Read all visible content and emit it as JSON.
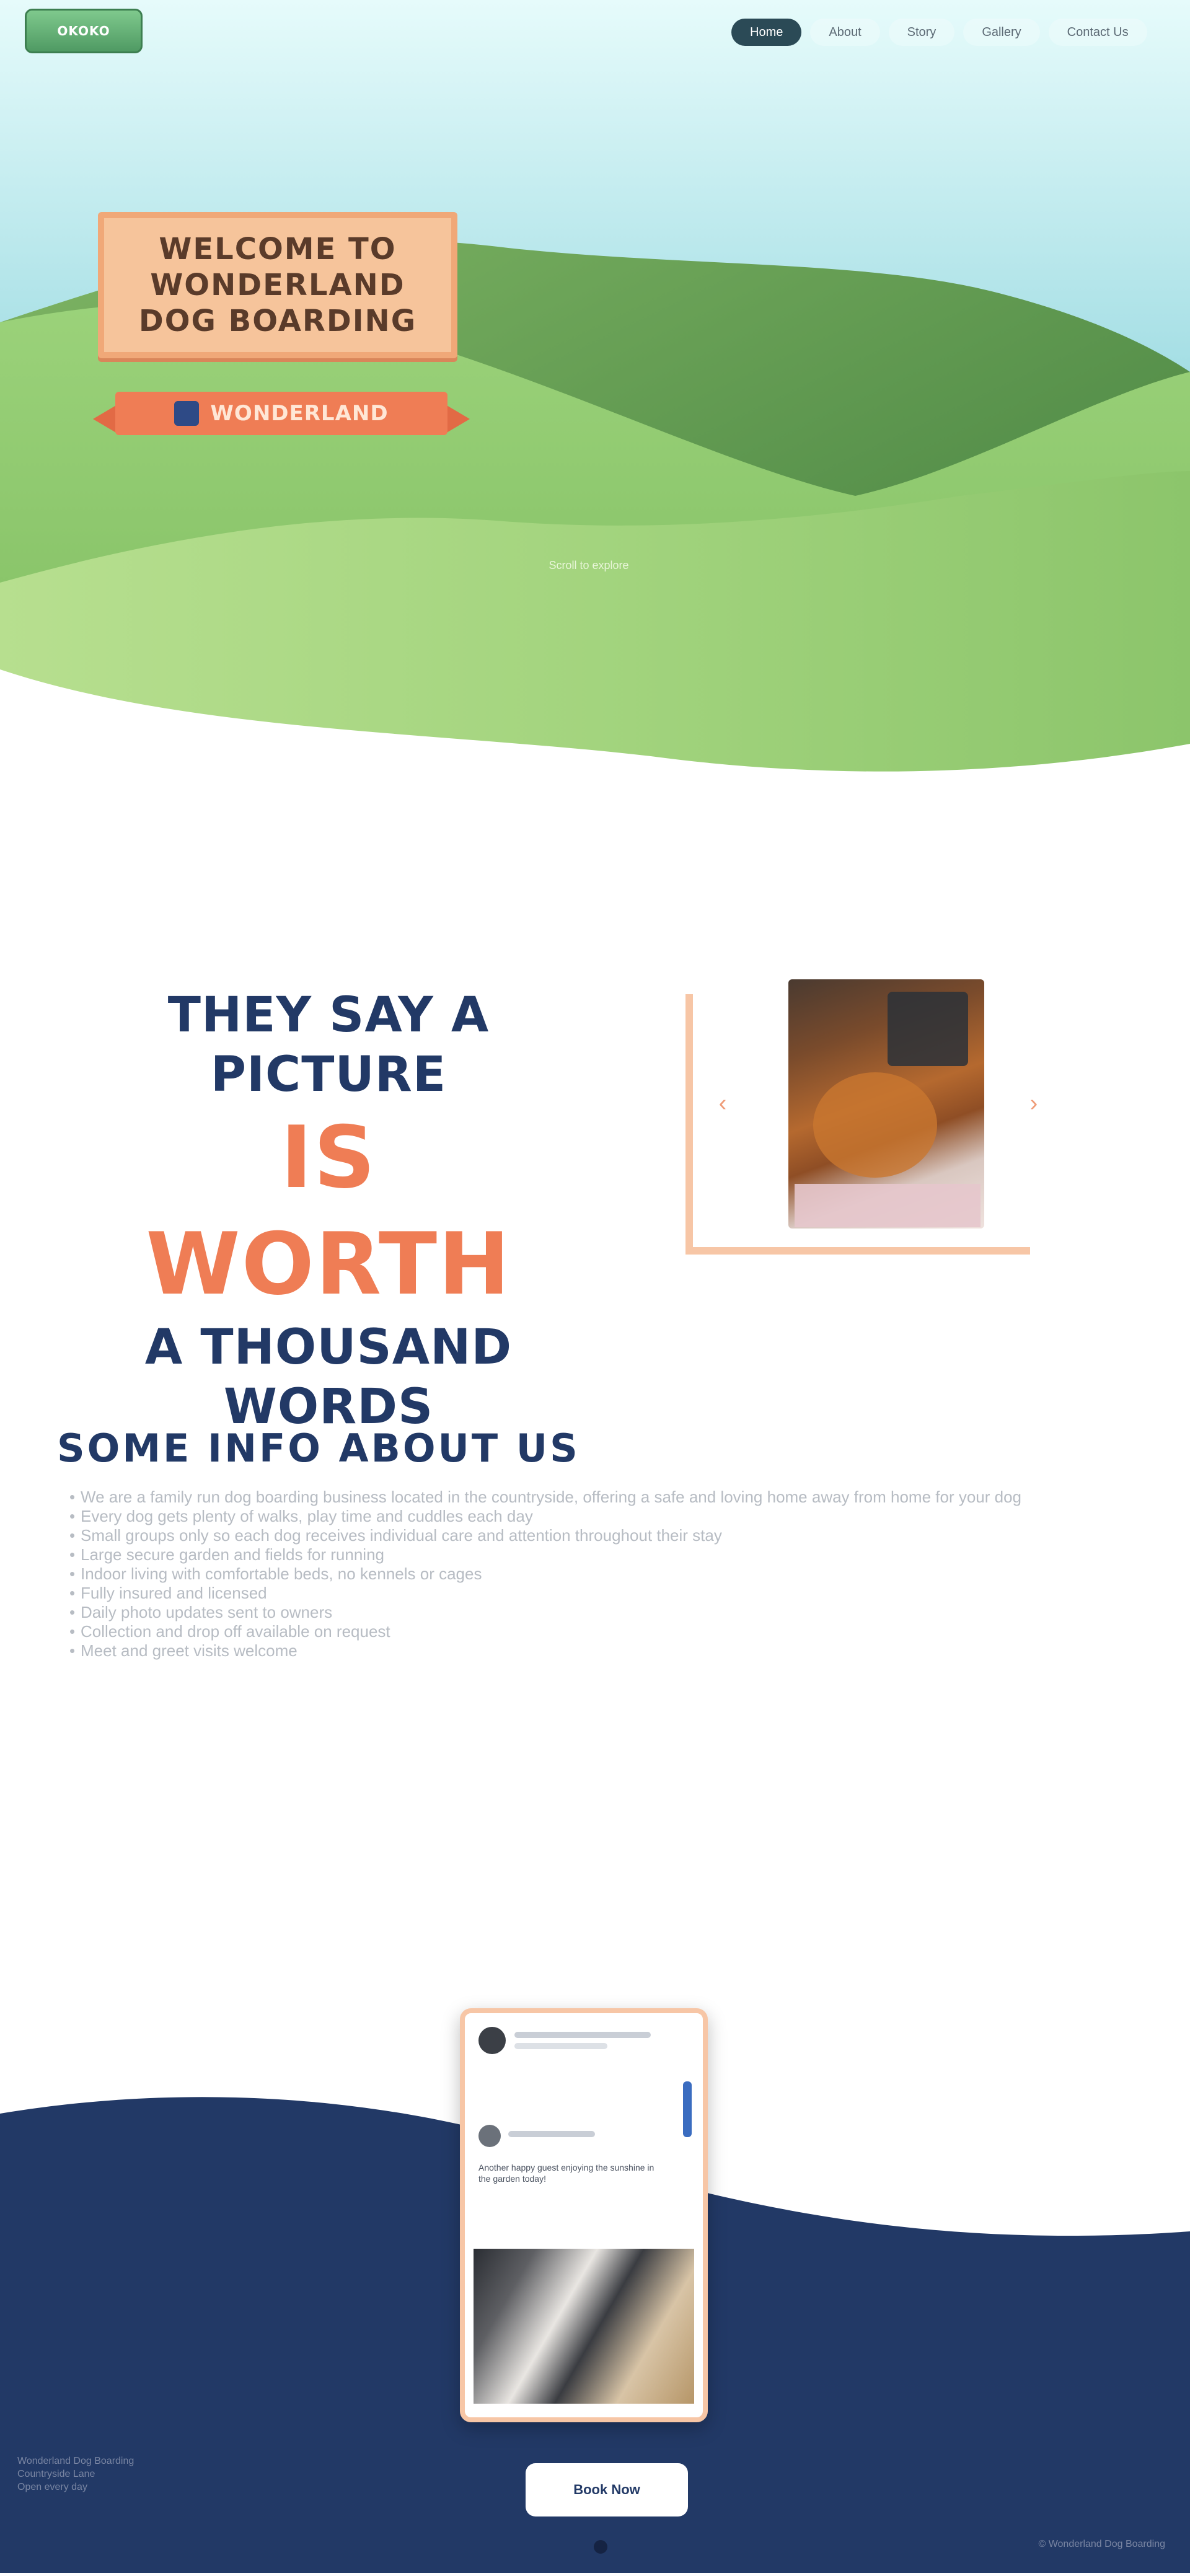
{
  "header": {
    "logo_text": "OKOKO",
    "nav": [
      {
        "label": "Home",
        "active": true
      },
      {
        "label": "About",
        "active": false
      },
      {
        "label": "Story",
        "active": false
      },
      {
        "label": "Gallery",
        "active": false
      },
      {
        "label": "Contact Us",
        "active": false
      }
    ]
  },
  "hero": {
    "sign_line1": "WELCOME TO",
    "sign_line2": "WONDERLAND",
    "sign_line3": "DOG BOARDING",
    "ribbon_text": "WONDERLAND",
    "caption": "Scroll to explore"
  },
  "picture_section": {
    "line1": "THEY SAY A PICTURE",
    "line2": "IS WORTH",
    "line3": "A THOUSAND WORDS",
    "prev_icon": "‹",
    "next_icon": "›"
  },
  "about": {
    "title": "SOME INFO ABOUT US",
    "items": [
      "We are a family run dog boarding business located in the countryside, offering a safe and loving home away from home for your dog",
      "Every dog gets plenty of walks, play time and cuddles each day",
      "Small groups only so each dog receives individual care and attention throughout their stay",
      "Large secure garden and fields for running",
      "Indoor living with comfortable beds, no kennels or cages",
      "Fully insured and licensed",
      "Daily photo updates sent to owners",
      "Collection and drop off available on request",
      "Meet and greet visits welcome"
    ]
  },
  "footer": {
    "phone_post_text": "Another happy guest enjoying the sunshine in the garden today!",
    "button_label": "Book Now",
    "left_text": "Wonderland Dog Boarding\nCountryside Lane\nOpen every day",
    "right_text": "© Wonderland Dog Boarding"
  },
  "colors": {
    "navy": "#223966",
    "coral": "#ef7d55",
    "peach": "#f7c6a6",
    "grass": "#8bc56a"
  }
}
